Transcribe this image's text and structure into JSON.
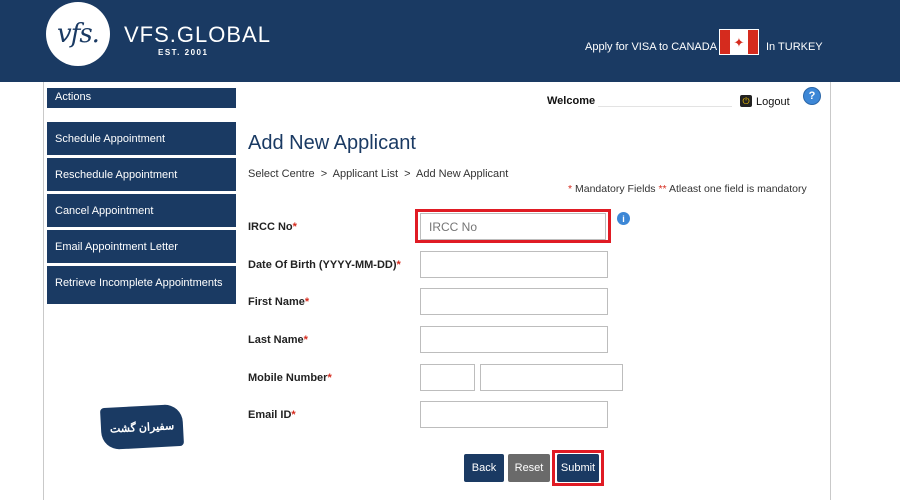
{
  "header": {
    "logo_text": "vfs.",
    "brand": "VFS.GLOBAL",
    "brand_sub": "EST. 2001",
    "apply_text": "Apply for VISA to CANADA",
    "country_text": "In TURKEY",
    "flag_icon": "canada-flag-icon",
    "flag_glyph": "✦"
  },
  "sidebar": {
    "title": "Actions",
    "items": [
      {
        "label": "Schedule Appointment"
      },
      {
        "label": "Reschedule Appointment"
      },
      {
        "label": "Cancel Appointment"
      },
      {
        "label": "Email Appointment Letter"
      },
      {
        "label": "Retrieve Incomplete Appointments"
      }
    ]
  },
  "watermark": "سفیران گشت",
  "topbar": {
    "welcome": "Welcome",
    "logout": "Logout",
    "logout_icon": "power-icon",
    "logout_glyph": "⏻",
    "help_glyph": "?"
  },
  "main": {
    "title": "Add New Applicant",
    "breadcrumb": [
      "Select Centre",
      ">",
      "Applicant List",
      ">",
      "Add New Applicant"
    ],
    "mandatory_star": "*",
    "mandatory_text": " Mandatory Fields ",
    "mandatory_star2": "**",
    "mandatory_text2": " Atleast one field is mandatory",
    "info_glyph": "i",
    "fields": {
      "ircc": {
        "label": "IRCC No",
        "placeholder": "IRCC No",
        "value": ""
      },
      "dob": {
        "label": "Date Of Birth (YYYY-MM-DD)",
        "value": ""
      },
      "first_name": {
        "label": "First Name",
        "value": ""
      },
      "last_name": {
        "label": "Last Name",
        "value": ""
      },
      "mobile": {
        "label": "Mobile Number",
        "code": "",
        "value": ""
      },
      "email": {
        "label": "Email ID",
        "value": ""
      }
    },
    "required_mark": "*",
    "buttons": {
      "back": "Back",
      "reset": "Reset",
      "submit": "Submit"
    }
  },
  "colors": {
    "brand_navy": "#1a3a63",
    "highlight_red": "#e01b24",
    "flag_red": "#d52b1e"
  }
}
